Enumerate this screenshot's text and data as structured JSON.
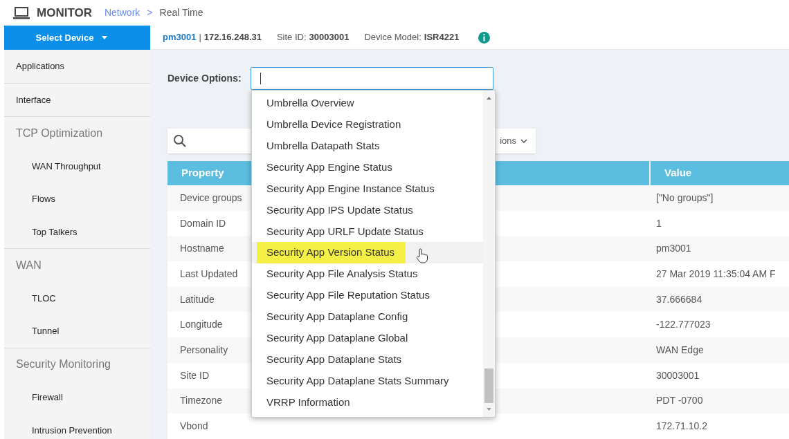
{
  "header": {
    "title": "MONITOR",
    "breadcrumb": [
      {
        "label": "Network",
        "link": true
      },
      {
        "label": "Real Time",
        "link": false
      }
    ],
    "separator": ">"
  },
  "select_device": {
    "label": "Select Device"
  },
  "sidebar": {
    "items": [
      {
        "label": "Applications"
      },
      {
        "label": "Interface"
      },
      {
        "label": "TCP Optimization",
        "children": [
          {
            "label": "WAN Throughput"
          },
          {
            "label": "Flows"
          },
          {
            "label": "Top Talkers"
          }
        ]
      },
      {
        "label": "WAN",
        "children": [
          {
            "label": "TLOC"
          },
          {
            "label": "Tunnel"
          }
        ]
      },
      {
        "label": "Security Monitoring",
        "children": [
          {
            "label": "Firewall"
          },
          {
            "label": "Intrusion Prevention"
          }
        ]
      }
    ]
  },
  "device_bar": {
    "hostname": "pm3001",
    "separator": "|",
    "ip": "172.16.248.31",
    "site_id_label": "Site ID:",
    "site_id": "30003001",
    "model_label": "Device Model:",
    "model": "ISR4221"
  },
  "device_options": {
    "label": "Device Options:",
    "dropdown": {
      "items": [
        {
          "label": "Umbrella Overview",
          "selected": false
        },
        {
          "label": "Umbrella Device Registration",
          "selected": false
        },
        {
          "label": "Umbrella Datapath Stats",
          "selected": false
        },
        {
          "label": "Security App Engine Status",
          "selected": false
        },
        {
          "label": "Security App Engine Instance Status",
          "selected": false
        },
        {
          "label": "Security App IPS Update Status",
          "selected": false
        },
        {
          "label": "Security App URLF Update Status",
          "selected": false
        },
        {
          "label": "Security App Version Status",
          "selected": true
        },
        {
          "label": "Security App File Analysis Status",
          "selected": false
        },
        {
          "label": "Security App File Reputation Status",
          "selected": false
        },
        {
          "label": "Security App Dataplane Config",
          "selected": false
        },
        {
          "label": "Security App Dataplane Global",
          "selected": false
        },
        {
          "label": "Security App Dataplane Stats",
          "selected": false
        },
        {
          "label": "Security App Dataplane Stats Summary",
          "selected": false
        },
        {
          "label": "VRRP Information",
          "selected": false
        }
      ]
    }
  },
  "options_button": {
    "label": "ions"
  },
  "table": {
    "columns": [
      "Property",
      "Value"
    ],
    "rows": [
      [
        "Device groups",
        "[\"No groups\"]"
      ],
      [
        "Domain ID",
        "1"
      ],
      [
        "Hostname",
        "pm3001"
      ],
      [
        "Last Updated",
        "27 Mar 2019 11:35:04 AM F"
      ],
      [
        "Latitude",
        "37.666684"
      ],
      [
        "Longitude",
        "-122.777023"
      ],
      [
        "Personality",
        "WAN Edge"
      ],
      [
        "Site ID",
        "30003001"
      ],
      [
        "Timezone",
        "PDT -0700"
      ],
      [
        "Vbond",
        "172.71.10.2"
      ]
    ]
  }
}
